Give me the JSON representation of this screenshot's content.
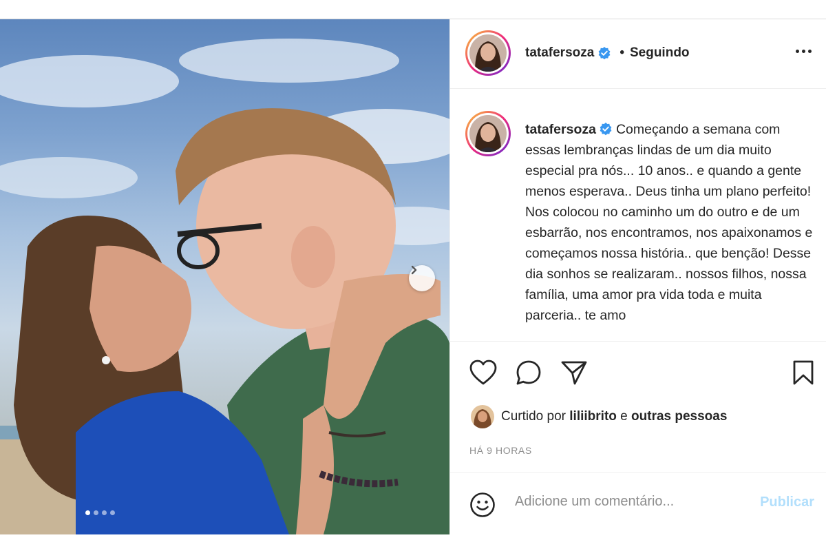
{
  "post": {
    "author": {
      "username": "tatafersoza",
      "verified_icon": "verified-badge-icon",
      "separator": "•",
      "follow_status": "Seguindo"
    },
    "caption": {
      "username": "tatafersoza",
      "text": "Começando a semana com essas lembranças lindas de um dia muito especial pra nós... 10 anos.. e quando a gente menos esperava.. Deus tinha um plano perfeito! Nos colocou no caminho um do outro e de um esbarrão, nos encontramos, nos apaixonamos e começamos nossa história.. que benção! Desse dia sonhos se realizaram.. nossos filhos, nossa família, uma amor pra vida toda e muita parceria.. te amo"
    },
    "carousel": {
      "total_slides": 4,
      "current_slide": 1
    },
    "likes": {
      "prefix": "Curtido por",
      "user": "liliibrito",
      "connector": "e",
      "others": "outras pessoas"
    },
    "timestamp": "HÁ 9 HORAS",
    "comment": {
      "placeholder": "Adicione um comentário...",
      "publish_label": "Publicar"
    }
  },
  "colors": {
    "verified": "#3897f0",
    "publish_disabled": "#b2dffc",
    "muted_text": "#8e8e8e"
  }
}
